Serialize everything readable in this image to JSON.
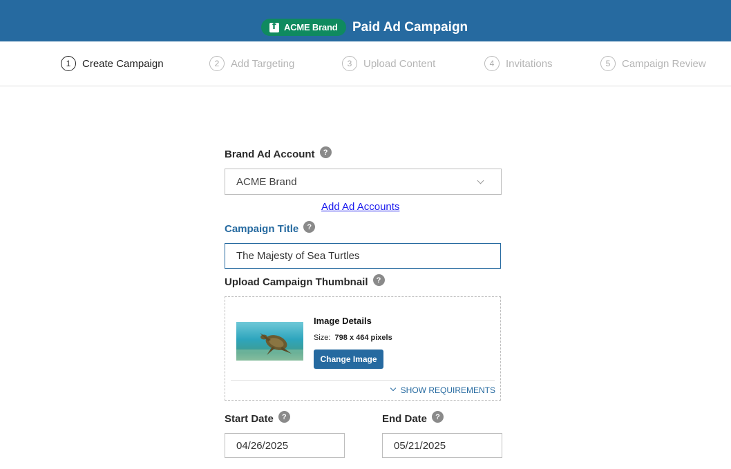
{
  "header": {
    "brand_badge": "ACME Brand",
    "title": "Paid Ad Campaign"
  },
  "steps": [
    {
      "num": "1",
      "label": "Create Campaign"
    },
    {
      "num": "2",
      "label": "Add Targeting"
    },
    {
      "num": "3",
      "label": "Upload Content"
    },
    {
      "num": "4",
      "label": "Invitations"
    },
    {
      "num": "5",
      "label": "Campaign Review"
    }
  ],
  "form": {
    "brand_account_label": "Brand Ad Account",
    "brand_account_value": "ACME Brand",
    "add_accounts_link": "Add Ad Accounts",
    "campaign_title_label": "Campaign Title",
    "campaign_title_value": "The Majesty of Sea Turtles",
    "thumbnail_label": "Upload Campaign Thumbnail",
    "image_details_title": "Image Details",
    "size_label": "Size:",
    "size_value": "798 x 464 pixels",
    "change_image_button": "Change Image",
    "show_requirements": "SHOW REQUIREMENTS",
    "start_date_label": "Start Date",
    "start_date_value": "04/26/2025",
    "end_date_label": "End Date",
    "end_date_value": "05/21/2025",
    "help_glyph": "?"
  },
  "colors": {
    "header_bg": "#266aa0",
    "brand_badge_bg": "#0f8a5f",
    "accent": "#266aa0",
    "link": "#1a1aee"
  }
}
